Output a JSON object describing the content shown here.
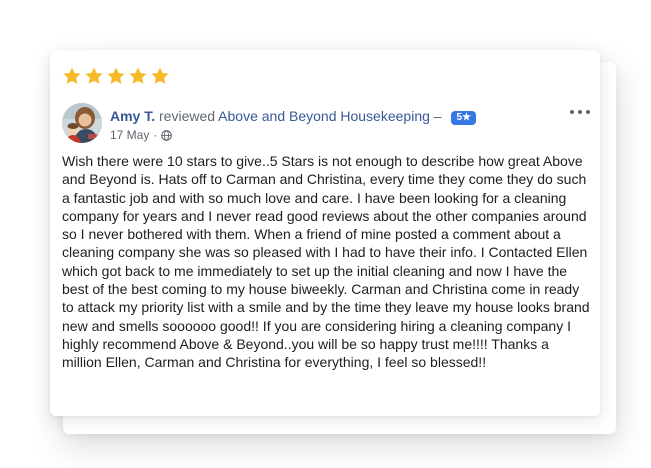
{
  "review": {
    "rating_stars": 5,
    "author": "Amy T.",
    "action": "reviewed",
    "page_name": "Above and Beyond Housekeeping",
    "dash": "–",
    "rating_badge": "5★",
    "date": "17 May",
    "separator": "·",
    "privacy_icon": "globe-icon",
    "more_icon": "more-options-icon",
    "text": "Wish there were 10 stars to give..5 Stars is not enough to describe how great Above and Beyond is. Hats off to Carman and Christina, every time they come they do such a fantastic job and with so much love and care. I have been looking for a cleaning company for years and I never read good reviews about the other companies around so I never bothered with them. When a friend of mine posted a comment about a cleaning company she was so pleased with I had to have their info. I Contacted Ellen which got back to me immediately to set up the initial cleaning and now I have the best of the best coming to my house biweekly. Carman and Christina come in ready to attack my priority list with a smile and by the time they leave my house looks brand new and smells soooooo good!! If you are considering hiring a cleaning company I highly recommend Above & Beyond..you will be so happy trust me!!!! Thanks a million Ellen, Carman and Christina for everything, I feel so blessed!!"
  },
  "colors": {
    "star": "#F7B928",
    "link": "#385898",
    "badge": "#3578E5",
    "text": "#1C1E21",
    "meta": "#606770"
  }
}
